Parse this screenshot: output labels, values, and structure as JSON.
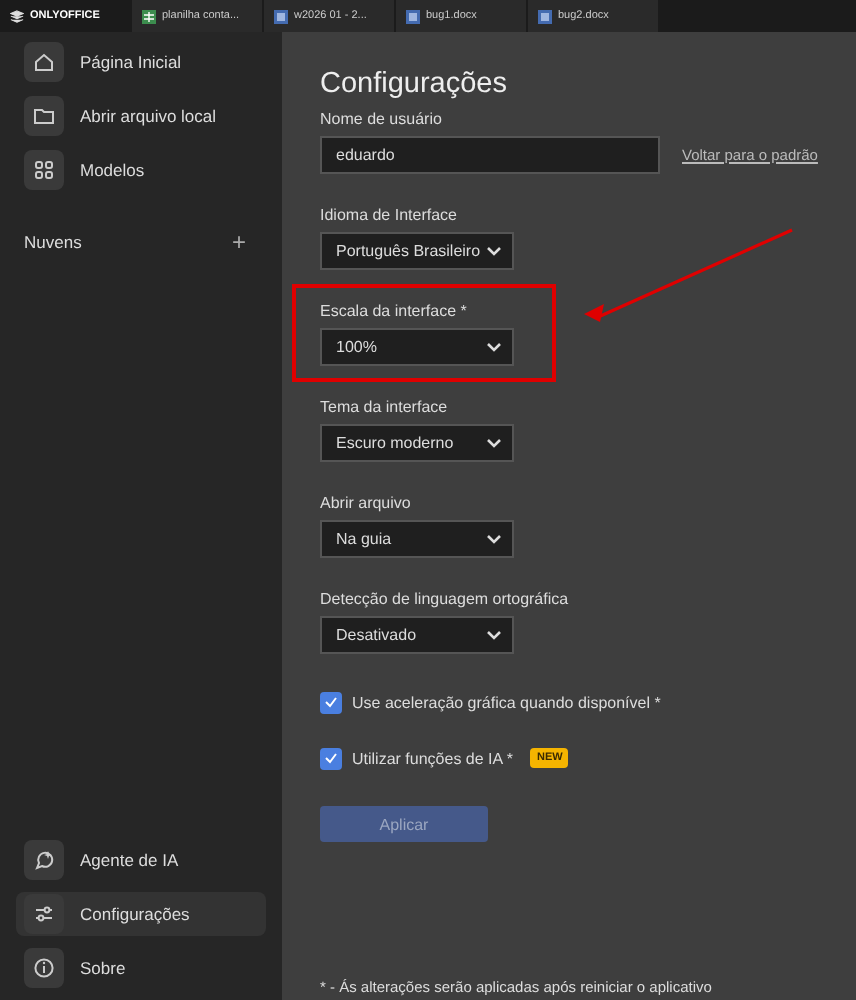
{
  "app_tabs": [
    {
      "kind": "logo",
      "label": "ONLYOFFICE"
    },
    {
      "kind": "sheet",
      "label": "planilha conta..."
    },
    {
      "kind": "doc",
      "label": "w2026 01 - 2..."
    },
    {
      "kind": "doc",
      "label": "bug1.docx"
    },
    {
      "kind": "doc",
      "label": "bug2.docx"
    }
  ],
  "sidebar": {
    "items": [
      {
        "kind": "home",
        "label": "Página Inicial",
        "selected": false
      },
      {
        "kind": "folder",
        "label": "Abrir arquivo local",
        "selected": false
      },
      {
        "kind": "grid",
        "label": "Modelos",
        "selected": false
      }
    ],
    "clouds": {
      "label": "Nuvens",
      "add": "+"
    },
    "bottom_items": [
      {
        "kind": "agent",
        "label": "Agente de IA",
        "selected": false
      },
      {
        "kind": "sliders",
        "label": "Configurações",
        "selected": true
      },
      {
        "kind": "info",
        "label": "Sobre",
        "selected": false
      }
    ]
  },
  "settings": {
    "title": "Configurações",
    "username": {
      "label": "Nome de usuário",
      "value": "eduardo",
      "reset_link": "Voltar para o padrão"
    },
    "selects": [
      {
        "label": "Idioma de Interface",
        "value": "Português Brasileiro",
        "highlighted": false
      },
      {
        "label": "Escala da interface *",
        "value": "100%",
        "highlighted": true
      },
      {
        "label": "Tema da interface",
        "value": "Escuro moderno",
        "highlighted": false
      },
      {
        "label": "Abrir arquivo",
        "value": "Na guia",
        "highlighted": false
      },
      {
        "label": "Detecção de linguagem ortográfica",
        "value": "Desativado",
        "highlighted": false
      }
    ],
    "checkboxes": [
      {
        "label": "Use aceleração gráfica quando disponível *",
        "checked": true
      },
      {
        "label": "Utilizar funções de IA *",
        "checked": true,
        "badge": "NEW"
      }
    ],
    "apply_button": {
      "label": "Aplicar",
      "disabled": true
    },
    "footnote": "* - Ás alterações serão aplicadas após reiniciar o aplicativo"
  }
}
